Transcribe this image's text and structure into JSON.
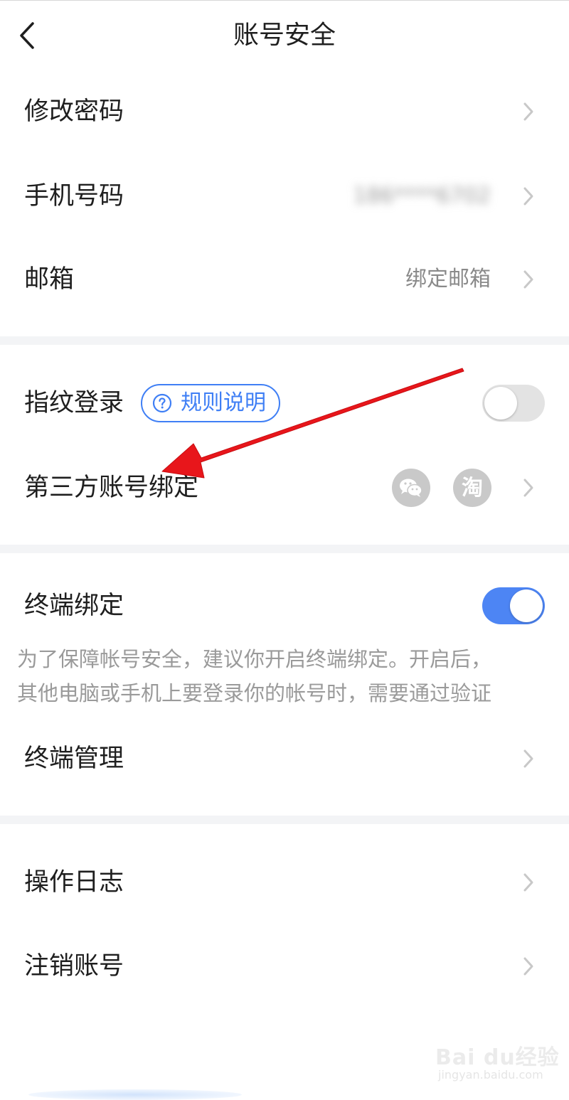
{
  "header": {
    "title": "账号安全"
  },
  "rows": {
    "change_password": {
      "label": "修改密码"
    },
    "phone": {
      "label": "手机号码",
      "value": "186****6702"
    },
    "email": {
      "label": "邮箱",
      "value": "绑定邮箱"
    },
    "fingerprint": {
      "label": "指纹登录",
      "rule_label": "规则说明",
      "enabled": false
    },
    "third_party": {
      "label": "第三方账号绑定",
      "icons": [
        "wechat-icon",
        "taobao-icon"
      ],
      "taobao_glyph": "淘"
    },
    "terminal_binding": {
      "label": "终端绑定",
      "enabled": true,
      "hint_line1": "为了保障帐号安全，建议你开启终端绑定。开启后，",
      "hint_line2": "其他电脑或手机上要登录你的帐号时，需要通过验证"
    },
    "terminal_manage": {
      "label": "终端管理"
    },
    "operation_log": {
      "label": "操作日志"
    },
    "cancel_account": {
      "label": "注销账号"
    }
  },
  "watermark": {
    "brand": "Bai du经验",
    "sub": "jingyan.baidu.com"
  },
  "colors": {
    "accent": "#3f7ff5",
    "toggle_on": "#4d85f4",
    "toggle_off": "#e3e3e3",
    "annotation_arrow": "#e8161b"
  }
}
